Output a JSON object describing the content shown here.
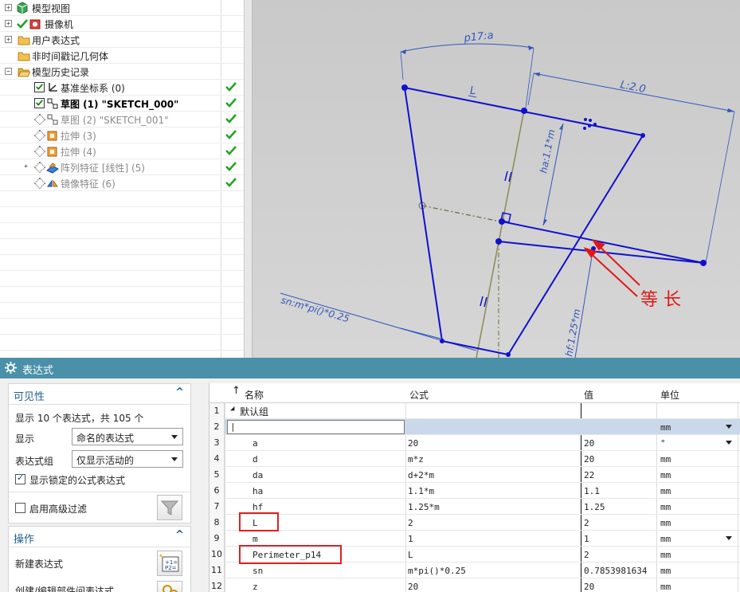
{
  "tree": {
    "items": [
      {
        "label": "模型视图"
      },
      {
        "label": "摄像机"
      },
      {
        "label": "用户表达式"
      },
      {
        "label": "非时间戳记几何体"
      },
      {
        "label": "模型历史记录"
      },
      {
        "label": "基准坐标系 (0)"
      },
      {
        "label": "草图 (1) \"SKETCH_000\""
      },
      {
        "label": "草图 (2) \"SKETCH_001\""
      },
      {
        "label": "拉伸 (3)"
      },
      {
        "label": "拉伸 (4)"
      },
      {
        "label": "阵列特征 [线性] (5)"
      },
      {
        "label": "镜像特征 (6)"
      }
    ]
  },
  "viewport": {
    "dims": {
      "p17": "p17:a",
      "L_lbl": "L",
      "L2": "L:2.0",
      "ha": "ha:1.1*m",
      "sn": "sn:m*pi()*0.25",
      "hf": "hf:1.25*m"
    },
    "annotation": "等 长",
    "line_color": "#1010d0",
    "annotation_color": "#e01818"
  },
  "dialog": {
    "title": "表达式",
    "visibility": {
      "title": "可见性",
      "count_text": "显示 10 个表达式，共 105 个",
      "display_label": "显示",
      "display_value": "命名的表达式",
      "group_label": "表达式组",
      "group_value": "仅显示活动的",
      "locked_label": "显示锁定的公式表达式",
      "advanced_label": "启用高级过滤"
    },
    "actions": {
      "title": "操作",
      "new_expr": "新建表达式",
      "create_edit": "创建/编辑部件间表达式"
    },
    "table": {
      "headers": {
        "name": "名称",
        "formula": "公式",
        "value": "值",
        "unit": "单位"
      },
      "group_label": "默认组",
      "edit_row_unit": "mm",
      "rows": [
        {
          "num": "1"
        },
        {
          "num": "2"
        },
        {
          "num": "3",
          "name": "a",
          "formula": "20",
          "value": "20",
          "unit": "°"
        },
        {
          "num": "4",
          "name": "d",
          "formula": "m*z",
          "value": "20",
          "unit": "mm"
        },
        {
          "num": "5",
          "name": "da",
          "formula": "d+2*m",
          "value": "22",
          "unit": "mm"
        },
        {
          "num": "6",
          "name": "ha",
          "formula": "1.1*m",
          "value": "1.1",
          "unit": "mm"
        },
        {
          "num": "7",
          "name": "hf",
          "formula": "1.25*m",
          "value": "1.25",
          "unit": "mm"
        },
        {
          "num": "8",
          "name": "L",
          "formula": "2",
          "value": "2",
          "unit": "mm"
        },
        {
          "num": "9",
          "name": "m",
          "formula": "1",
          "value": "1",
          "unit": "mm"
        },
        {
          "num": "10",
          "name": "Perimeter_p14",
          "formula": "L",
          "value": "2",
          "unit": "mm"
        },
        {
          "num": "11",
          "name": "sn",
          "formula": "m*pi()*0.25",
          "value": "0.7853981634",
          "unit": "mm"
        },
        {
          "num": "12",
          "name": "z",
          "formula": "20",
          "value": "20",
          "unit": "mm"
        }
      ]
    }
  }
}
